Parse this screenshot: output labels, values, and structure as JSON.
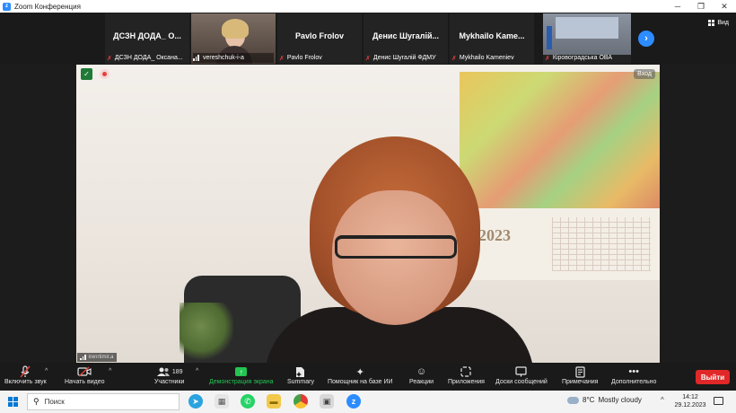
{
  "window": {
    "title": "Zoom Конференция",
    "minimize_glyph": "─",
    "maximize_glyph": "❐",
    "close_glyph": "✕"
  },
  "strip": {
    "view_label": "Вид",
    "next_glyph": "›",
    "tiles": [
      {
        "name": "ДСЗН ДОДА_ О...",
        "label": "ДСЗН ДОДА_ Оксана..."
      },
      {
        "name": "",
        "label": "vereshchuk-i-a"
      },
      {
        "name": "Pavlo Frolov",
        "label": "Pavlo Frolov"
      },
      {
        "name": "Денис  Шугалій...",
        "label": "Денис Шугалій ФДМУ"
      },
      {
        "name": "Mykhailo  Kame...",
        "label": "Mykhailo Kameniev"
      },
      {
        "name": "",
        "label": "Кіровоградська ОВА"
      }
    ]
  },
  "video": {
    "enter_label": "Вход",
    "signal_label": "irenrtimir.a",
    "calendar_year": "2023"
  },
  "toolbar": {
    "mute": "Включить звук",
    "video": "Начать видео",
    "participants": "Участники",
    "participants_count": "189",
    "share": "Демонстрация экрана",
    "summary": "Summary",
    "ai": "Помощник на базе ИИ",
    "reactions": "Реакции",
    "apps": "Приложения",
    "whiteboard": "Доски сообщений",
    "notes": "Примечания",
    "more": "Дополнительно",
    "leave": "Выйти"
  },
  "taskbar": {
    "search": "Поиск",
    "weather_temp": "8°C",
    "weather_desc": "Mostly cloudy",
    "time": "14:12",
    "date": "29.12.2023"
  },
  "colors": {
    "accent": "#2d8cff",
    "leave": "#e02828",
    "share": "#23c552"
  }
}
